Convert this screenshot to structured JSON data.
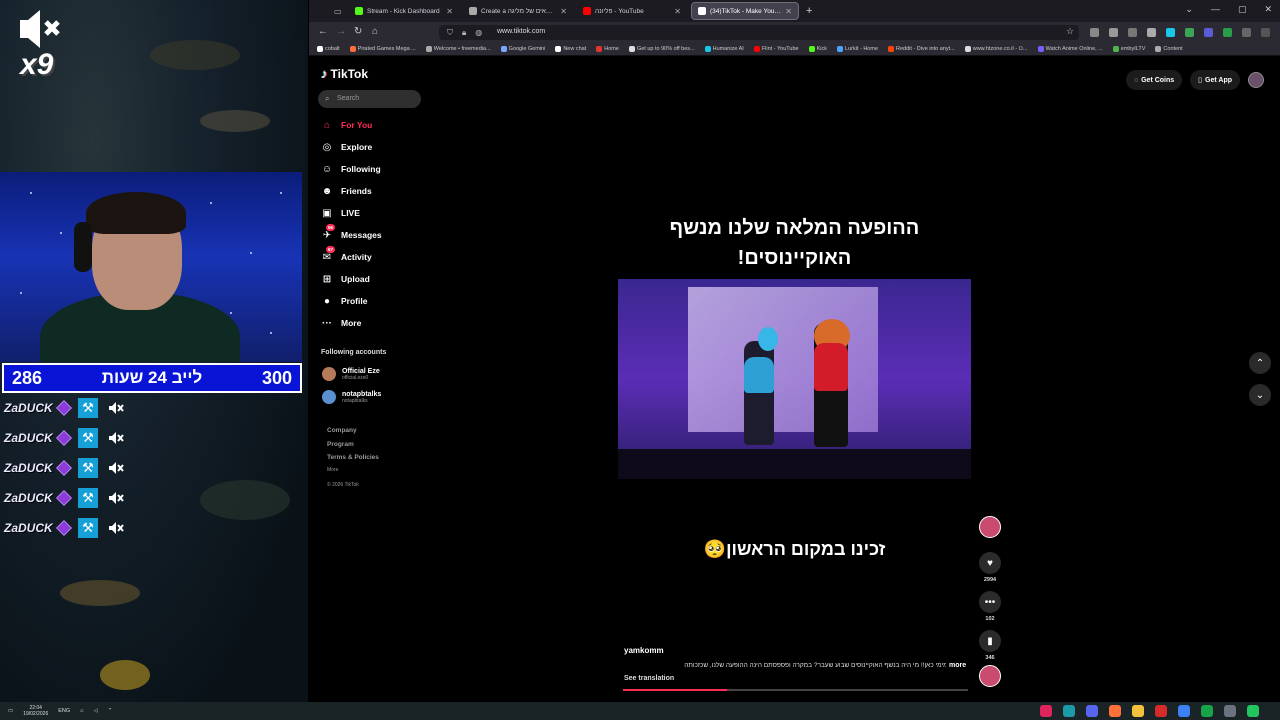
{
  "overlay": {
    "mute_count": "x9",
    "timer": {
      "left": "286",
      "label": "לייב 24 שעות",
      "right": "300"
    },
    "mod_rows": [
      "ZaDUCK",
      "ZaDUCK",
      "ZaDUCK",
      "ZaDUCK",
      "ZaDUCK"
    ]
  },
  "browser": {
    "tabs": [
      {
        "label": "Stream - Kick Dashboard",
        "icon": "kick-icon",
        "color": "#53fc18"
      },
      {
        "label": "Create a דירוג בנפאים של מליגה",
        "icon": "page-icon",
        "color": "#aaaaaa"
      },
      {
        "label": "פליונה - YouTube",
        "icon": "youtube-icon",
        "color": "#ff0000"
      },
      {
        "label": "(34)TikTok - Make Your Day",
        "icon": "tiktok-icon",
        "color": "#ffffff",
        "active": true
      }
    ],
    "url": "www.tiktok.com",
    "bookmarks": [
      {
        "label": "cobalt",
        "color": "#ffffff"
      },
      {
        "label": "Pirated Games Mega ...",
        "color": "#ff6d3a"
      },
      {
        "label": "Welcome • freemedia...",
        "color": "#aaaaaa"
      },
      {
        "label": "Google Gemini",
        "color": "#7aa7ff"
      },
      {
        "label": "New chat",
        "color": "#ffffff"
      },
      {
        "label": "Home",
        "color": "#e3342f"
      },
      {
        "label": "Get up to 90% off bes...",
        "color": "#dddddd"
      },
      {
        "label": "Humanize AI",
        "color": "#1ac7e8"
      },
      {
        "label": "Flint - YouTube",
        "color": "#ff0000"
      },
      {
        "label": "Kick",
        "color": "#53fc18"
      },
      {
        "label": "Lurkit - Home",
        "color": "#4aa3ff"
      },
      {
        "label": "Reddit - Dive into anyt...",
        "color": "#ff4500"
      },
      {
        "label": "www.htzone.co.il - כו...",
        "color": "#dddddd"
      },
      {
        "label": "Watch Anime Online, ...",
        "color": "#7b5cff"
      },
      {
        "label": "embyILTV",
        "color": "#52b54b"
      },
      {
        "label": "Content",
        "color": "#aaaaaa"
      }
    ]
  },
  "tiktok": {
    "logo": "TikTok",
    "search_placeholder": "Search",
    "nav": [
      {
        "label": "For You",
        "icon": "home-icon",
        "glyph": "⌂",
        "active": true
      },
      {
        "label": "Explore",
        "icon": "compass-icon",
        "glyph": "◎"
      },
      {
        "label": "Following",
        "icon": "following-icon",
        "glyph": "☺"
      },
      {
        "label": "Friends",
        "icon": "friends-icon",
        "glyph": "☻"
      },
      {
        "label": "LIVE",
        "icon": "live-icon",
        "glyph": "▣"
      },
      {
        "label": "Messages",
        "icon": "messages-icon",
        "glyph": "✈",
        "badge": "56"
      },
      {
        "label": "Activity",
        "icon": "activity-icon",
        "glyph": "✉",
        "badge": "67"
      },
      {
        "label": "Upload",
        "icon": "upload-icon",
        "glyph": "⊞"
      },
      {
        "label": "Profile",
        "icon": "profile-icon",
        "glyph": "●"
      },
      {
        "label": "More",
        "icon": "more-icon",
        "glyph": "···"
      }
    ],
    "following_title": "Following accounts",
    "accounts": [
      {
        "name": "Official Eze",
        "handle": "official.eze0",
        "color": "#b57a5a"
      },
      {
        "name": "notapbtalks",
        "handle": "notapbtalks",
        "color": "#5a8fd0"
      }
    ],
    "footer": {
      "links": [
        "Company",
        "Program",
        "Terms & Policies"
      ],
      "more": "More",
      "copyright": "© 2026 TikTok"
    },
    "top_right": {
      "coins": "Get Coins",
      "app": "Get App"
    },
    "video": {
      "title": "ההופעה המלאה שלנו מנשף האוקיינוסים!",
      "subtitle": "זכינו במקום הראשון🥺",
      "author": "yamkomm",
      "description": "שישי ומימי כאן!! מי היה בנשף האוקיינוסים שבוע שעבר? במקרה ופספסתם הינה ההופעה שלנו, שכזכותה",
      "more": "more",
      "translate": "See translation",
      "progress": 0.3
    },
    "actions": {
      "likes": "2994",
      "comments": "102",
      "saves": "346"
    }
  },
  "taskbar": {
    "lang": "ENG",
    "time": "22:04",
    "date": "19/02/2026"
  }
}
